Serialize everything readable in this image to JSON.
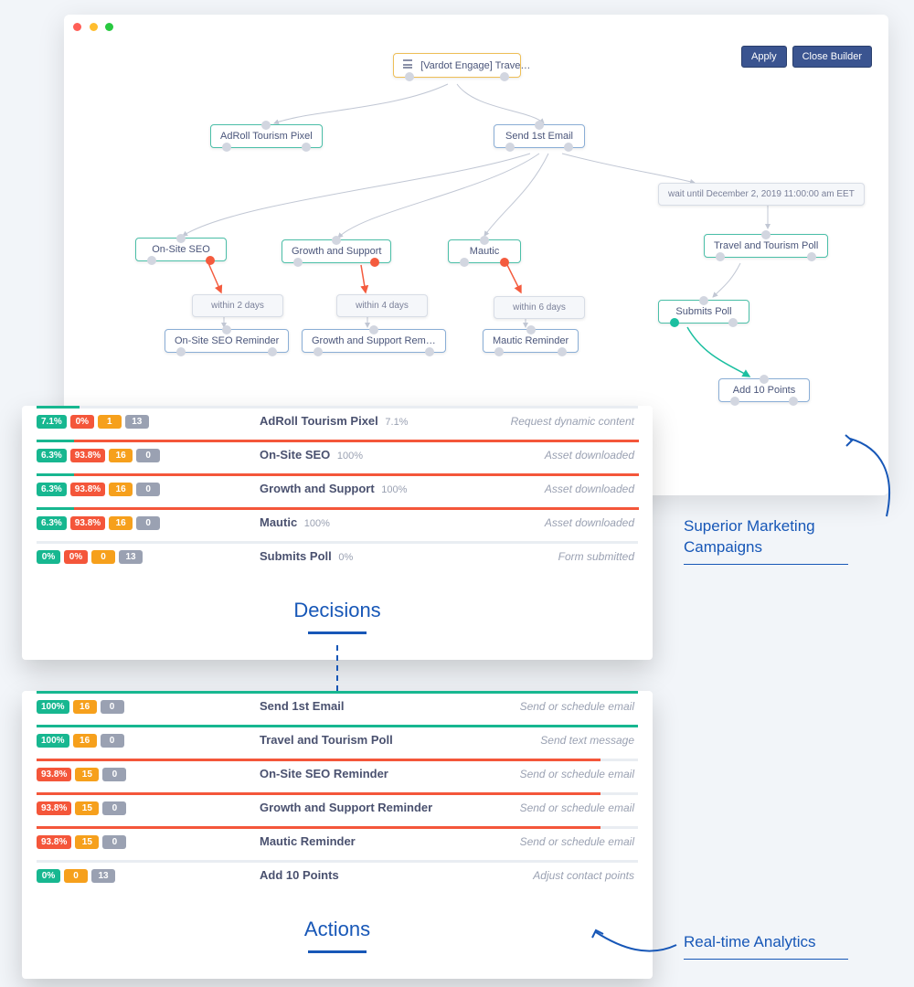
{
  "builder": {
    "root_label": "[Vardot Engage] Trave…",
    "buttons": {
      "apply": "Apply",
      "close": "Close Builder"
    },
    "nodes": {
      "adroll": {
        "label": "AdRoll Tourism Pixel"
      },
      "send1": {
        "label": "Send 1st Email"
      },
      "wait": {
        "label": "wait until December 2, 2019 11:00:00 am EET"
      },
      "seo": {
        "label": "On-Site SEO"
      },
      "growth": {
        "label": "Growth and Support"
      },
      "mautic": {
        "label": "Mautic"
      },
      "tpoll": {
        "label": "Travel and Tourism Poll"
      },
      "w2": {
        "label": "within 2 days"
      },
      "w4": {
        "label": "within 4 days"
      },
      "w6": {
        "label": "within 6 days"
      },
      "seo_r": {
        "label": "On-Site SEO Reminder"
      },
      "growth_r": {
        "label": "Growth and Support Rem…"
      },
      "mautic_r": {
        "label": "Mautic Reminder"
      },
      "submits": {
        "label": "Submits Poll"
      },
      "add10": {
        "label": "Add 10 Points"
      }
    }
  },
  "decisions": {
    "title": "Decisions",
    "rows": [
      {
        "pct1": "7.1%",
        "pct2": "0%",
        "n1": "1",
        "n2": "13",
        "name": "AdRoll Tourism Pixel",
        "name_pct": "7.1%",
        "type": "Request dynamic content",
        "bar_g": 7.1,
        "bar_r": 0
      },
      {
        "pct1": "6.3%",
        "pct2": "93.8%",
        "n1": "16",
        "n2": "0",
        "name": "On-Site SEO",
        "name_pct": "100%",
        "type": "Asset downloaded",
        "bar_g": 6.3,
        "bar_r": 93.8
      },
      {
        "pct1": "6.3%",
        "pct2": "93.8%",
        "n1": "16",
        "n2": "0",
        "name": "Growth and Support",
        "name_pct": "100%",
        "type": "Asset downloaded",
        "bar_g": 6.3,
        "bar_r": 93.8
      },
      {
        "pct1": "6.3%",
        "pct2": "93.8%",
        "n1": "16",
        "n2": "0",
        "name": "Mautic",
        "name_pct": "100%",
        "type": "Asset downloaded",
        "bar_g": 6.3,
        "bar_r": 93.8
      },
      {
        "pct1": "0%",
        "pct2": "0%",
        "n1": "0",
        "n2": "13",
        "name": "Submits Poll",
        "name_pct": "0%",
        "type": "Form submitted",
        "bar_g": 0,
        "bar_r": 0
      }
    ]
  },
  "actions": {
    "title": "Actions",
    "rows": [
      {
        "pct1": "100%",
        "n1": "16",
        "n2": "0",
        "name": "Send 1st Email",
        "type": "Send or schedule email",
        "bar_g": 100,
        "bar_r": 0
      },
      {
        "pct1": "100%",
        "n1": "16",
        "n2": "0",
        "name": "Travel and Tourism Poll",
        "type": "Send text message",
        "bar_g": 100,
        "bar_r": 0
      },
      {
        "pct1": "93.8%",
        "n1": "15",
        "n2": "0",
        "name": "On-Site SEO Reminder",
        "type": "Send or schedule email",
        "bar_g": 0,
        "bar_r": 93.8
      },
      {
        "pct1": "93.8%",
        "n1": "15",
        "n2": "0",
        "name": "Growth and Support Reminder",
        "type": "Send or schedule email",
        "bar_g": 0,
        "bar_r": 93.8
      },
      {
        "pct1": "93.8%",
        "n1": "15",
        "n2": "0",
        "name": "Mautic Reminder",
        "type": "Send or schedule email",
        "bar_g": 0,
        "bar_r": 93.8
      },
      {
        "pct1": "0%",
        "n1": "0",
        "n2": "13",
        "name": "Add 10 Points",
        "type": "Adjust contact points",
        "bar_g": 0,
        "bar_r": 0
      }
    ]
  },
  "annotations": {
    "campaigns": "Superior Marketing Campaigns",
    "analytics": "Real-time Analytics"
  },
  "chart_data": {
    "type": "table",
    "title": "Campaign step completion rates",
    "decisions": [
      {
        "name": "AdRoll Tourism Pixel",
        "success_pct": 7.1,
        "fail_pct": 0,
        "count_a": 1,
        "count_b": 13,
        "row_pct": 7.1,
        "action_type": "Request dynamic content"
      },
      {
        "name": "On-Site SEO",
        "success_pct": 6.3,
        "fail_pct": 93.8,
        "count_a": 16,
        "count_b": 0,
        "row_pct": 100,
        "action_type": "Asset downloaded"
      },
      {
        "name": "Growth and Support",
        "success_pct": 6.3,
        "fail_pct": 93.8,
        "count_a": 16,
        "count_b": 0,
        "row_pct": 100,
        "action_type": "Asset downloaded"
      },
      {
        "name": "Mautic",
        "success_pct": 6.3,
        "fail_pct": 93.8,
        "count_a": 16,
        "count_b": 0,
        "row_pct": 100,
        "action_type": "Asset downloaded"
      },
      {
        "name": "Submits Poll",
        "success_pct": 0,
        "fail_pct": 0,
        "count_a": 0,
        "count_b": 13,
        "row_pct": 0,
        "action_type": "Form submitted"
      }
    ],
    "actions": [
      {
        "name": "Send 1st Email",
        "pct": 100,
        "count_a": 16,
        "count_b": 0,
        "action_type": "Send or schedule email"
      },
      {
        "name": "Travel and Tourism Poll",
        "pct": 100,
        "count_a": 16,
        "count_b": 0,
        "action_type": "Send text message"
      },
      {
        "name": "On-Site SEO Reminder",
        "pct": 93.8,
        "count_a": 15,
        "count_b": 0,
        "action_type": "Send or schedule email"
      },
      {
        "name": "Growth and Support Reminder",
        "pct": 93.8,
        "count_a": 15,
        "count_b": 0,
        "action_type": "Send or schedule email"
      },
      {
        "name": "Mautic Reminder",
        "pct": 93.8,
        "count_a": 15,
        "count_b": 0,
        "action_type": "Send or schedule email"
      },
      {
        "name": "Add 10 Points",
        "pct": 0,
        "count_a": 0,
        "count_b": 13,
        "action_type": "Adjust contact points"
      }
    ]
  }
}
